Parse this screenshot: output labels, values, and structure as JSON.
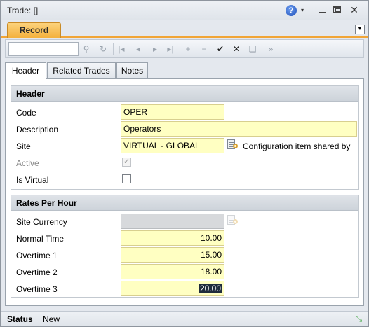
{
  "window": {
    "title": "Trade: []",
    "help_glyph": "?",
    "help_caret": "▾",
    "close_glyph": "✕"
  },
  "record_tab": {
    "label": "Record",
    "dropdown_glyph": "▼"
  },
  "toolbar": {
    "search_value": "",
    "icons": [
      "search-icon",
      "refresh-icon",
      "first-record-icon",
      "previous-record-icon",
      "next-record-icon",
      "last-record-icon",
      "add-icon",
      "delete-icon",
      "save-icon",
      "cancel-icon",
      "actions-icon",
      "more-icon"
    ],
    "glyphs": {
      "search": "⚲",
      "refresh": "↻",
      "first": "|◂",
      "prev": "◂",
      "next": "▸",
      "last": "▸|",
      "add": "+",
      "delete": "−",
      "save": "✔",
      "cancel": "✕",
      "actions": "❏",
      "more": "»"
    }
  },
  "tabs": [
    {
      "label": "Header",
      "active": true
    },
    {
      "label": "Related Trades",
      "active": false
    },
    {
      "label": "Notes",
      "active": false
    }
  ],
  "header_section": {
    "title": "Header",
    "code_label": "Code",
    "code_value": "OPER",
    "description_label": "Description",
    "description_value": "Operators",
    "site_label": "Site",
    "site_value": "VIRTUAL - GLOBAL",
    "site_note": "Configuration item shared by",
    "active_label": "Active",
    "active_checked": true,
    "active_check_glyph": "✓",
    "is_virtual_label": "Is Virtual",
    "is_virtual_checked": false
  },
  "rates_section": {
    "title": "Rates Per Hour",
    "site_currency_label": "Site Currency",
    "site_currency_value": "",
    "normal_time_label": "Normal Time",
    "normal_time_value": "10.00",
    "overtime1_label": "Overtime 1",
    "overtime1_value": "15.00",
    "overtime2_label": "Overtime 2",
    "overtime2_value": "18.00",
    "overtime3_label": "Overtime 3",
    "overtime3_value": "20.00"
  },
  "status": {
    "label": "Status",
    "value": "New",
    "expand_glyph": "⤡"
  },
  "colors": {
    "record_tab": "#f4b13c",
    "field_bg": "#ffffc2",
    "status_expand": "#3aa33a"
  }
}
